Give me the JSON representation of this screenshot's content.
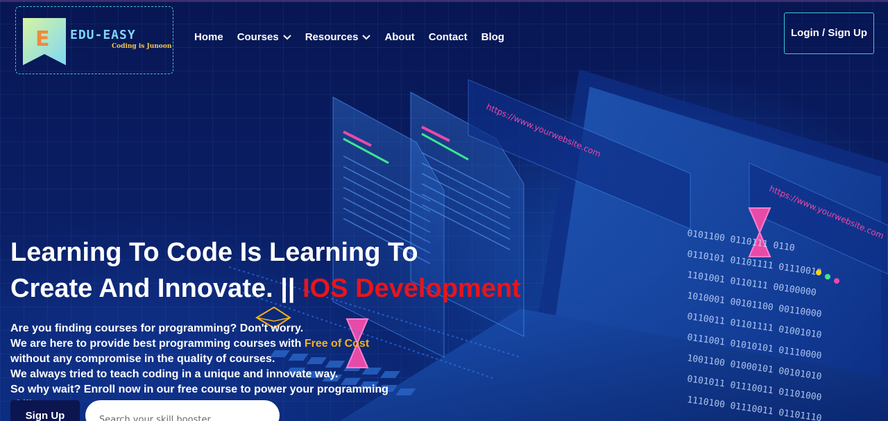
{
  "brand": {
    "logo_letter": "E",
    "name": "EDU-EASY",
    "tagline": "Coding is Junoon"
  },
  "nav": {
    "items": [
      {
        "label": "Home",
        "has_dropdown": false
      },
      {
        "label": "Courses",
        "has_dropdown": true
      },
      {
        "label": "Resources",
        "has_dropdown": true
      },
      {
        "label": "About",
        "has_dropdown": false
      },
      {
        "label": "Contact",
        "has_dropdown": false
      },
      {
        "label": "Blog",
        "has_dropdown": false
      }
    ],
    "login_label": "Login / Sign Up"
  },
  "hero": {
    "headline_line1": "Learning To Code Is Learning To",
    "headline_line2": "Create And Innovate. ||",
    "headline_accent": "IOS Development",
    "desc_line1": "Are you finding courses for programming? Don't worry.",
    "desc_line2_pre": "We are here to provide best programming courses with",
    "desc_line2_accent": "Free of Cost",
    "desc_line3": "without any compromise in the quality of courses.",
    "desc_line4": "We always tried to teach coding in a unique and innovate way.",
    "desc_line5": "So why wait? Enroll now in our free course to power your programming skills.",
    "signup_label": "Sign Up",
    "search_placeholder": "Search your skill booster"
  },
  "art": {
    "url_text_1": "https://www.yourwebsite.com",
    "url_text_2": "https://www.yourwebsite.com",
    "binary_rows": [
      "0101100 0110111 0110",
      "0110101 01101111 01110010",
      "1101001 0110111 00100000",
      "1010001 00101100 00110000",
      "0110011 01101111 01001010",
      "0111001 01010101 01110000",
      "1001100 01000101 00101010",
      "0101011 01110011 01101000",
      "1110100 01110011 01101110"
    ],
    "colors": {
      "accent_red": "#e8151b",
      "accent_orange": "#f6b21a",
      "accent_teal": "#3fc7d6",
      "pink": "#e84aa8",
      "green": "#3ee48f"
    }
  }
}
